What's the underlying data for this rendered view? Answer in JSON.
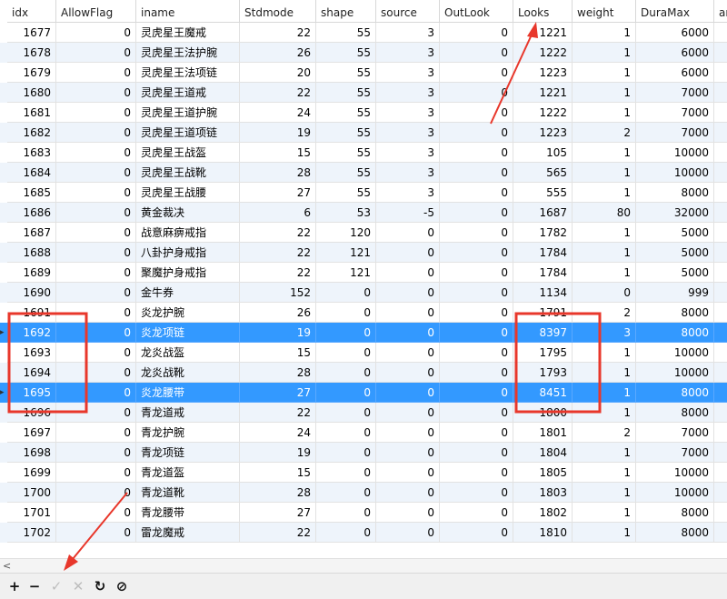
{
  "columns": [
    "idx",
    "AllowFlag",
    "iname",
    "Stdmode",
    "shape",
    "source",
    "OutLook",
    "Looks",
    "weight",
    "DuraMax",
    "an"
  ],
  "rows": [
    [
      "1677",
      "0",
      "灵虎星王魔戒",
      "22",
      "55",
      "3",
      "0",
      "1221",
      "1",
      "6000"
    ],
    [
      "1678",
      "0",
      "灵虎星王法护腕",
      "26",
      "55",
      "3",
      "0",
      "1222",
      "1",
      "6000"
    ],
    [
      "1679",
      "0",
      "灵虎星王法项链",
      "20",
      "55",
      "3",
      "0",
      "1223",
      "1",
      "6000"
    ],
    [
      "1680",
      "0",
      "灵虎星王道戒",
      "22",
      "55",
      "3",
      "0",
      "1221",
      "1",
      "7000"
    ],
    [
      "1681",
      "0",
      "灵虎星王道护腕",
      "24",
      "55",
      "3",
      "0",
      "1222",
      "1",
      "7000"
    ],
    [
      "1682",
      "0",
      "灵虎星王道项链",
      "19",
      "55",
      "3",
      "0",
      "1223",
      "2",
      "7000"
    ],
    [
      "1683",
      "0",
      "灵虎星王战盔",
      "15",
      "55",
      "3",
      "0",
      "105",
      "1",
      "10000"
    ],
    [
      "1684",
      "0",
      "灵虎星王战靴",
      "28",
      "55",
      "3",
      "0",
      "565",
      "1",
      "10000"
    ],
    [
      "1685",
      "0",
      "灵虎星王战腰",
      "27",
      "55",
      "3",
      "0",
      "555",
      "1",
      "8000"
    ],
    [
      "1686",
      "0",
      "黄金裁决",
      "6",
      "53",
      "-5",
      "0",
      "1687",
      "80",
      "32000"
    ],
    [
      "1687",
      "0",
      "战意麻痹戒指",
      "22",
      "120",
      "0",
      "0",
      "1782",
      "1",
      "5000"
    ],
    [
      "1688",
      "0",
      "八卦护身戒指",
      "22",
      "121",
      "0",
      "0",
      "1784",
      "1",
      "5000"
    ],
    [
      "1689",
      "0",
      "聚魔护身戒指",
      "22",
      "121",
      "0",
      "0",
      "1784",
      "1",
      "5000"
    ],
    [
      "1690",
      "0",
      "金牛券",
      "152",
      "0",
      "0",
      "0",
      "1134",
      "0",
      "999"
    ],
    [
      "1691",
      "0",
      "炎龙护腕",
      "26",
      "0",
      "0",
      "0",
      "1791",
      "2",
      "8000"
    ],
    [
      "1692",
      "0",
      "炎龙项链",
      "19",
      "0",
      "0",
      "0",
      "8397",
      "3",
      "8000"
    ],
    [
      "1693",
      "0",
      "龙炎战盔",
      "15",
      "0",
      "0",
      "0",
      "1795",
      "1",
      "10000"
    ],
    [
      "1694",
      "0",
      "龙炎战靴",
      "28",
      "0",
      "0",
      "0",
      "1793",
      "1",
      "10000"
    ],
    [
      "1695",
      "0",
      "炎龙腰带",
      "27",
      "0",
      "0",
      "0",
      "8451",
      "1",
      "8000"
    ],
    [
      "1696",
      "0",
      "青龙道戒",
      "22",
      "0",
      "0",
      "0",
      "1800",
      "1",
      "8000"
    ],
    [
      "1697",
      "0",
      "青龙护腕",
      "24",
      "0",
      "0",
      "0",
      "1801",
      "2",
      "7000"
    ],
    [
      "1698",
      "0",
      "青龙项链",
      "19",
      "0",
      "0",
      "0",
      "1804",
      "1",
      "7000"
    ],
    [
      "1699",
      "0",
      "青龙道盔",
      "15",
      "0",
      "0",
      "0",
      "1805",
      "1",
      "10000"
    ],
    [
      "1700",
      "0",
      "青龙道靴",
      "28",
      "0",
      "0",
      "0",
      "1803",
      "1",
      "10000"
    ],
    [
      "1701",
      "0",
      "青龙腰带",
      "27",
      "0",
      "0",
      "0",
      "1802",
      "1",
      "8000"
    ],
    [
      "1702",
      "0",
      "雷龙魔戒",
      "22",
      "0",
      "0",
      "0",
      "1810",
      "1",
      "8000"
    ]
  ],
  "selected_rows": [
    15,
    18
  ],
  "toolbar": {
    "add": "+",
    "remove": "−",
    "apply": "✓",
    "discard": "✕",
    "refresh": "↻",
    "stop": "⊘"
  },
  "scroll_left_arrow": "<",
  "colors": {
    "selection": "#3399ff",
    "alt_row": "#eef4fb",
    "annotation": "#e8372b"
  }
}
